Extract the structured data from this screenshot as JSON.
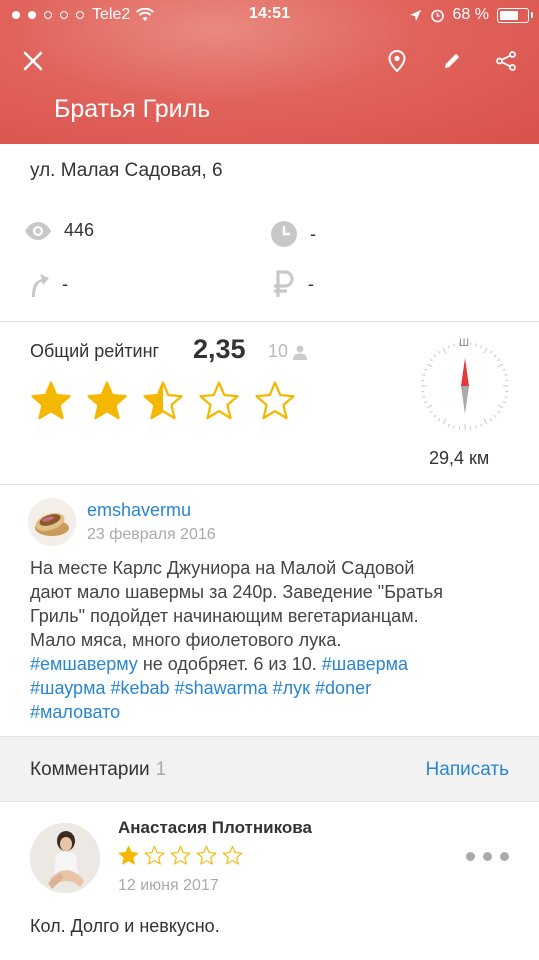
{
  "status_bar": {
    "carrier": "Tele2",
    "time": "14:51",
    "battery": "68 %"
  },
  "header": {
    "title": "Братья Гриль",
    "close_icon": "close-icon",
    "location_icon": "location-pin-icon",
    "edit_icon": "pencil-icon",
    "share_icon": "share-icon",
    "color": "#e0635b"
  },
  "place": {
    "address": "ул. Малая Садовая, 6",
    "views": "446",
    "hours": "-",
    "route": "-",
    "price": "-"
  },
  "rating": {
    "label": "Общий рейтинг",
    "value": "2,35",
    "votes": "10",
    "stars": 2.5,
    "max_stars": 5,
    "distance": "29,4 км",
    "compass_letter": "Ш"
  },
  "post": {
    "author": "emshavermu",
    "date": "23 февраля 2016",
    "text_line1": "На месте Карлс Джуниора на Малой Садовой",
    "text_line2": "дают мало шавермы за 240р. Заведение \"Братья",
    "text_line3": "Гриль\" подойдет начинающим вегетарианцам.",
    "text_line4": "Мало мяса, много фиолетового лука.",
    "tag1": "#емшаверму",
    "text_mid": " не одобряет. 6 из 10. ",
    "tag2": "#шаверма",
    "tag3": "#шаурма",
    "tag4": "#kebab",
    "tag5": "#shawarma",
    "tag6": "#лук",
    "tag7": "#doner",
    "tag8": "#маловато"
  },
  "comments": {
    "label": "Комментарии",
    "count": "1",
    "write": "Написать",
    "items": [
      {
        "author": "Анастасия Плотникова",
        "stars": 1,
        "date": "12 июня 2017",
        "text": "Кол. Долго и невкусно."
      }
    ]
  },
  "colors": {
    "accent_blue": "#2a86d0",
    "star_gold": "#f5b800"
  }
}
